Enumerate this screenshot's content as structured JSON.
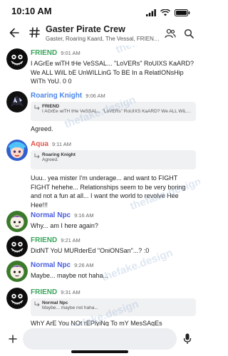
{
  "status_bar": {
    "time": "10:10 AM",
    "wifi_icon": "wifi-icon",
    "signal_icon": "signal-icon",
    "battery_icon": "battery-icon"
  },
  "header": {
    "title": "Gaster Pirate Crew",
    "members": "Gaster, Roaring Kaard, The Vessal, FRIEND, Ro...",
    "back_icon": "arrow-left-icon",
    "hash_icon": "hash-icon",
    "members_icon": "members-icon",
    "search_icon": "search-icon"
  },
  "colors": {
    "friend": "#3aa55c",
    "roaring_knight": "#4a86e8",
    "aqua": "#e0554a",
    "normal_npc": "#4a5de0"
  },
  "messages": [
    {
      "author": "FRIEND",
      "time": "9:01 AM",
      "text": "I AGrEe wiTH tHe VeSSAL... \"LoVERs\" RoUIXS KaARD? We ALL WilL bE UnWILLinG To BE In a RelatIONsHip WiTh YoU. 0 0"
    },
    {
      "author": "Roaring Knight",
      "time": "9:06 AM",
      "reply_author": "FRIEND",
      "reply_text": "I AGrEe wiTH tHe VeSSAL... \"LoVERs\" RoUIXS KaARD? We ALL WiLL bE",
      "text": "Agreed."
    },
    {
      "author": "Aqua",
      "time": "9:11 AM",
      "reply_author": "Roaring Knight",
      "reply_text": "Agreed.",
      "text": "Uuu.. yea mister I'm underage... and want to FIGHT FIGHT hehehe... Relationships seem to be very boring and not a fun at all... I want the world to revolve Hee Hee!!!"
    },
    {
      "author": "Normal Npc",
      "time": "9:16 AM",
      "text": "Why... am I here again?"
    },
    {
      "author": "FRIEND",
      "time": "9:21 AM",
      "text": "DidNT YoU MURderEd \"OniONSan\"...? :0"
    },
    {
      "author": "Normal Npc",
      "time": "9:26 AM",
      "text": "Maybe... maybe not haha..."
    },
    {
      "author": "FRIEND",
      "time": "9:31 AM",
      "reply_author": "Normal Npc",
      "reply_text": "Maybe... maybe not haha...",
      "text": "WhY ArE You NOt rEPlyiNg To mY MesSAgEs"
    }
  ],
  "watermark": "thefake.design",
  "composer": {
    "placeholder": "",
    "add_icon": "plus-icon",
    "mic_icon": "mic-icon"
  }
}
